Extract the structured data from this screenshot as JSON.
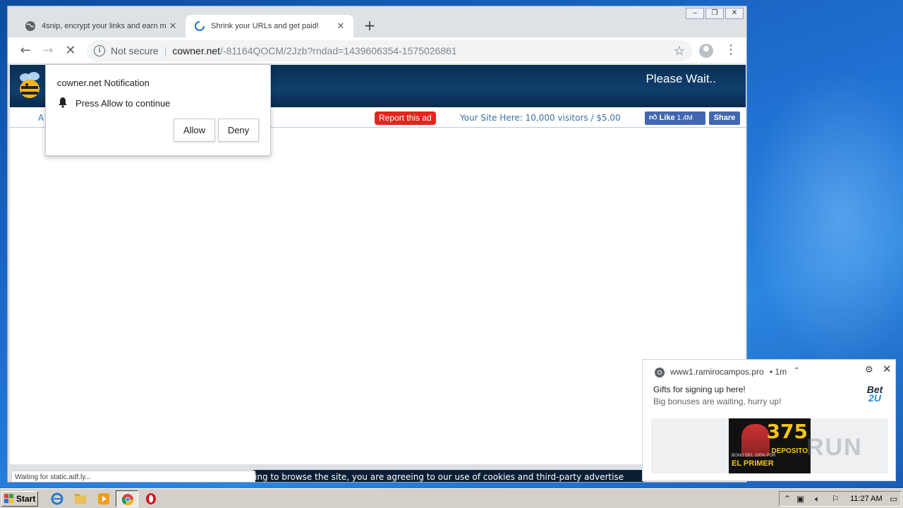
{
  "browser": {
    "tabs": [
      {
        "title": "4snip, encrypt your links and earn m",
        "state": "inactive"
      },
      {
        "title": "Shrink your URLs and get paid!",
        "state": "active"
      }
    ],
    "omnibox": {
      "security_label": "Not secure",
      "url_host": "cowner.net",
      "url_path": "/-81164QOCM/2Jzb?rndad=1439606354-1575026861"
    },
    "status_bubble": "Waiting for static.adf.ly..."
  },
  "page": {
    "banner_text": "Please Wait..",
    "adbar_left": "A",
    "report_ad": "Report this ad",
    "your_site": "Your Site Here: 10,000 visitors / $5.00",
    "fb_like_label": "Like",
    "fb_like_count": "1.4M",
    "fb_share_label": "Share",
    "cookie_text": "ing to browse the site, you are agreeing to our use of cookies and third-party advertise"
  },
  "permission_prompt": {
    "title": "cowner.net Notification",
    "message": "Press Allow to continue",
    "allow_label": "Allow",
    "deny_label": "Deny"
  },
  "toast": {
    "source": "www1.ramirocampos.pro",
    "time": "1m",
    "title": "Gifts for signing up here!",
    "body": "Big bonuses are waiting, hurry up!",
    "logo_top": "Bet",
    "logo_bottom": "2U",
    "ad_number": "375",
    "ad_line1": "BONO DEL 100% POR",
    "ad_line2": "EL PRIMER",
    "ad_deposit": "DEPOSITO",
    "watermark": "RUN"
  },
  "taskbar": {
    "start_label": "Start",
    "clock": "11:27 AM"
  },
  "colors": {
    "banner": "#0f3f6e",
    "report_ad": "#e8221c",
    "facebook": "#4267b2",
    "desktop": "#1f6fd0"
  }
}
